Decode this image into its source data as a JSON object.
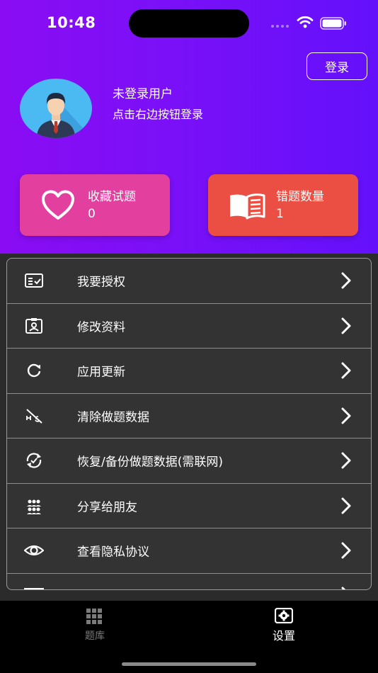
{
  "status_bar": {
    "time": "10:48"
  },
  "header": {
    "login_label": "登录",
    "user_name": "未登录用户",
    "user_hint": "点击右边按钮登录"
  },
  "stats": {
    "favorites": {
      "label": "收藏试题",
      "value": "0",
      "icon": "heart-icon",
      "color": "#e23f9f"
    },
    "wrong": {
      "label": "错题数量",
      "value": "1",
      "icon": "book-icon",
      "color": "#eb4f44"
    }
  },
  "menu": {
    "items": [
      {
        "label": "我要授权",
        "icon": "license-icon"
      },
      {
        "label": "修改资料",
        "icon": "profile-card-icon"
      },
      {
        "label": "应用更新",
        "icon": "refresh-icon"
      },
      {
        "label": "清除做题数据",
        "icon": "clear-data-icon"
      },
      {
        "label": "恢复/备份做题数据(需联网)",
        "icon": "sync-icon"
      },
      {
        "label": "分享给朋友",
        "icon": "share-people-icon"
      },
      {
        "label": "查看隐私协议",
        "icon": "eye-icon"
      }
    ]
  },
  "tabs": {
    "questions": {
      "label": "题库",
      "icon": "grid-icon"
    },
    "settings": {
      "label": "设置",
      "icon": "settings-icon"
    }
  },
  "colors": {
    "header_gradient_start": "#8a0cf3",
    "header_gradient_end": "#6410fb",
    "menu_background": "#333333",
    "tab_bar_background": "#000000",
    "active_tab": "#ffffff",
    "inactive_tab": "#7b7b7b"
  }
}
